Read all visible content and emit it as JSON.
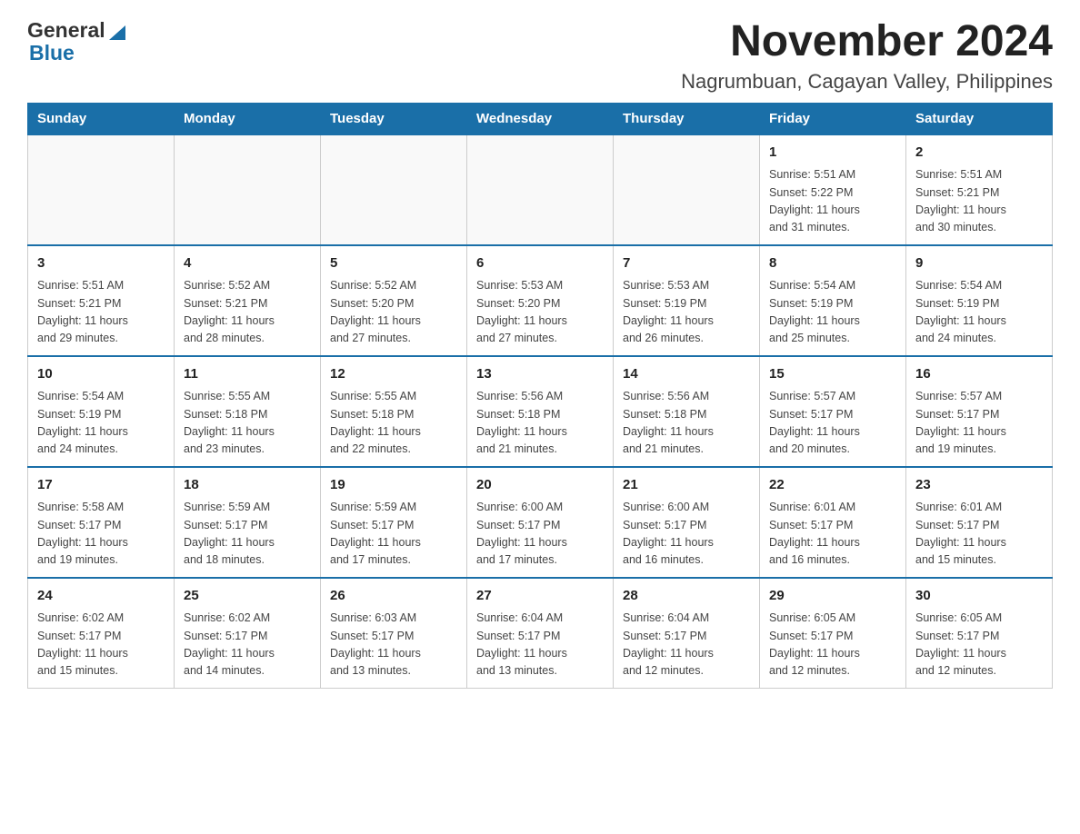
{
  "logo": {
    "general": "General",
    "blue": "Blue",
    "triangle": "▶"
  },
  "title": "November 2024",
  "location": "Nagrumbuan, Cagayan Valley, Philippines",
  "weekdays": [
    "Sunday",
    "Monday",
    "Tuesday",
    "Wednesday",
    "Thursday",
    "Friday",
    "Saturday"
  ],
  "weeks": [
    [
      {
        "day": "",
        "info": ""
      },
      {
        "day": "",
        "info": ""
      },
      {
        "day": "",
        "info": ""
      },
      {
        "day": "",
        "info": ""
      },
      {
        "day": "",
        "info": ""
      },
      {
        "day": "1",
        "info": "Sunrise: 5:51 AM\nSunset: 5:22 PM\nDaylight: 11 hours\nand 31 minutes."
      },
      {
        "day": "2",
        "info": "Sunrise: 5:51 AM\nSunset: 5:21 PM\nDaylight: 11 hours\nand 30 minutes."
      }
    ],
    [
      {
        "day": "3",
        "info": "Sunrise: 5:51 AM\nSunset: 5:21 PM\nDaylight: 11 hours\nand 29 minutes."
      },
      {
        "day": "4",
        "info": "Sunrise: 5:52 AM\nSunset: 5:21 PM\nDaylight: 11 hours\nand 28 minutes."
      },
      {
        "day": "5",
        "info": "Sunrise: 5:52 AM\nSunset: 5:20 PM\nDaylight: 11 hours\nand 27 minutes."
      },
      {
        "day": "6",
        "info": "Sunrise: 5:53 AM\nSunset: 5:20 PM\nDaylight: 11 hours\nand 27 minutes."
      },
      {
        "day": "7",
        "info": "Sunrise: 5:53 AM\nSunset: 5:19 PM\nDaylight: 11 hours\nand 26 minutes."
      },
      {
        "day": "8",
        "info": "Sunrise: 5:54 AM\nSunset: 5:19 PM\nDaylight: 11 hours\nand 25 minutes."
      },
      {
        "day": "9",
        "info": "Sunrise: 5:54 AM\nSunset: 5:19 PM\nDaylight: 11 hours\nand 24 minutes."
      }
    ],
    [
      {
        "day": "10",
        "info": "Sunrise: 5:54 AM\nSunset: 5:19 PM\nDaylight: 11 hours\nand 24 minutes."
      },
      {
        "day": "11",
        "info": "Sunrise: 5:55 AM\nSunset: 5:18 PM\nDaylight: 11 hours\nand 23 minutes."
      },
      {
        "day": "12",
        "info": "Sunrise: 5:55 AM\nSunset: 5:18 PM\nDaylight: 11 hours\nand 22 minutes."
      },
      {
        "day": "13",
        "info": "Sunrise: 5:56 AM\nSunset: 5:18 PM\nDaylight: 11 hours\nand 21 minutes."
      },
      {
        "day": "14",
        "info": "Sunrise: 5:56 AM\nSunset: 5:18 PM\nDaylight: 11 hours\nand 21 minutes."
      },
      {
        "day": "15",
        "info": "Sunrise: 5:57 AM\nSunset: 5:17 PM\nDaylight: 11 hours\nand 20 minutes."
      },
      {
        "day": "16",
        "info": "Sunrise: 5:57 AM\nSunset: 5:17 PM\nDaylight: 11 hours\nand 19 minutes."
      }
    ],
    [
      {
        "day": "17",
        "info": "Sunrise: 5:58 AM\nSunset: 5:17 PM\nDaylight: 11 hours\nand 19 minutes."
      },
      {
        "day": "18",
        "info": "Sunrise: 5:59 AM\nSunset: 5:17 PM\nDaylight: 11 hours\nand 18 minutes."
      },
      {
        "day": "19",
        "info": "Sunrise: 5:59 AM\nSunset: 5:17 PM\nDaylight: 11 hours\nand 17 minutes."
      },
      {
        "day": "20",
        "info": "Sunrise: 6:00 AM\nSunset: 5:17 PM\nDaylight: 11 hours\nand 17 minutes."
      },
      {
        "day": "21",
        "info": "Sunrise: 6:00 AM\nSunset: 5:17 PM\nDaylight: 11 hours\nand 16 minutes."
      },
      {
        "day": "22",
        "info": "Sunrise: 6:01 AM\nSunset: 5:17 PM\nDaylight: 11 hours\nand 16 minutes."
      },
      {
        "day": "23",
        "info": "Sunrise: 6:01 AM\nSunset: 5:17 PM\nDaylight: 11 hours\nand 15 minutes."
      }
    ],
    [
      {
        "day": "24",
        "info": "Sunrise: 6:02 AM\nSunset: 5:17 PM\nDaylight: 11 hours\nand 15 minutes."
      },
      {
        "day": "25",
        "info": "Sunrise: 6:02 AM\nSunset: 5:17 PM\nDaylight: 11 hours\nand 14 minutes."
      },
      {
        "day": "26",
        "info": "Sunrise: 6:03 AM\nSunset: 5:17 PM\nDaylight: 11 hours\nand 13 minutes."
      },
      {
        "day": "27",
        "info": "Sunrise: 6:04 AM\nSunset: 5:17 PM\nDaylight: 11 hours\nand 13 minutes."
      },
      {
        "day": "28",
        "info": "Sunrise: 6:04 AM\nSunset: 5:17 PM\nDaylight: 11 hours\nand 12 minutes."
      },
      {
        "day": "29",
        "info": "Sunrise: 6:05 AM\nSunset: 5:17 PM\nDaylight: 11 hours\nand 12 minutes."
      },
      {
        "day": "30",
        "info": "Sunrise: 6:05 AM\nSunset: 5:17 PM\nDaylight: 11 hours\nand 12 minutes."
      }
    ]
  ]
}
